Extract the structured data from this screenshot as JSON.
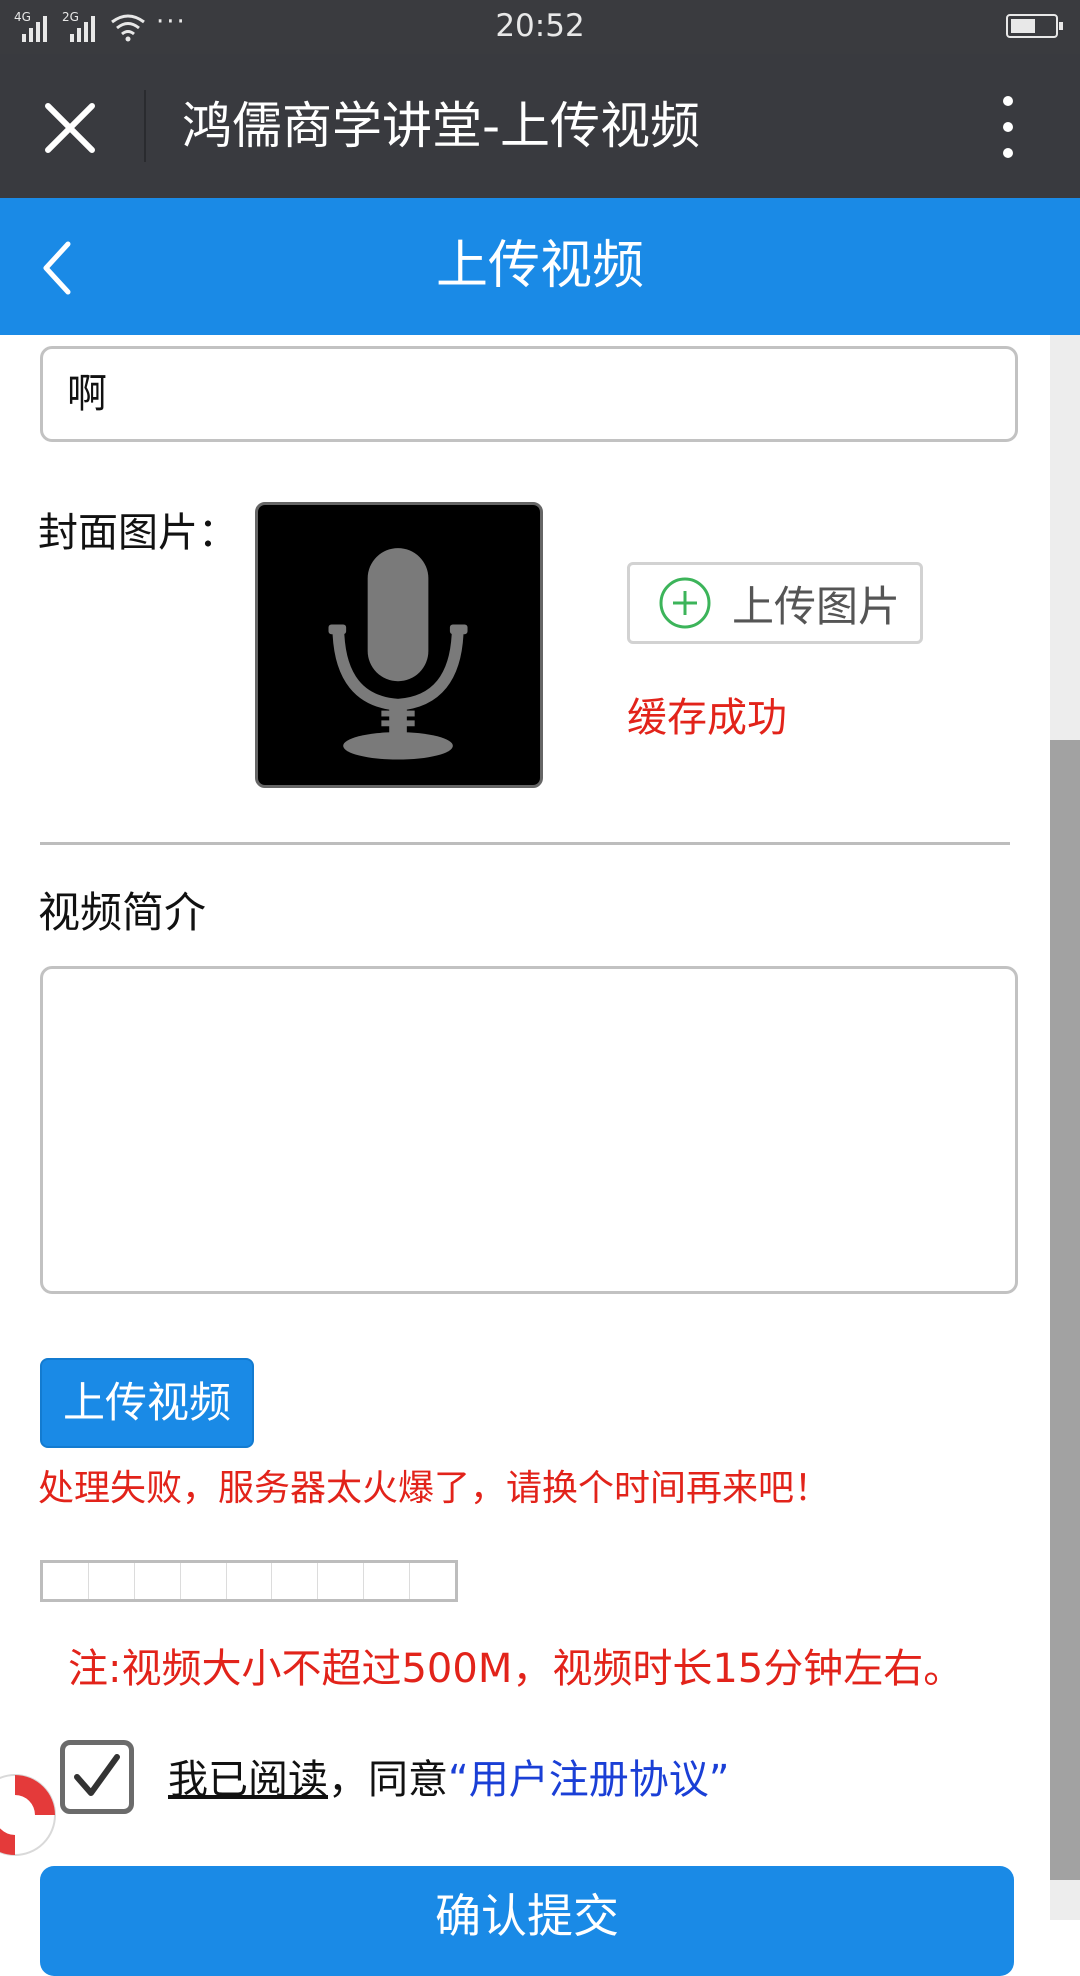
{
  "status_bar": {
    "network_1": "4G",
    "network_2": "2G",
    "more_dots": "···",
    "time": "20:52"
  },
  "wechat_nav": {
    "title": "鸿儒商学讲堂-上传视频"
  },
  "header": {
    "title": "上传视频"
  },
  "form": {
    "title_value": "啊",
    "cover_label": "封面图片：",
    "upload_image_label": "上传图片",
    "cache_status": "缓存成功",
    "intro_label": "视频简介",
    "intro_value": "",
    "upload_video_label": "上传视频",
    "error_message": "处理失败，服务器太火爆了，请换个时间再来吧！",
    "progress": 0,
    "note": "注:视频大小不超过500M，视频时长15分钟左右。",
    "agree": {
      "checked": true,
      "read_text": "我已阅读",
      "comma_text": "，同意",
      "link_text": "“用户注册协议”"
    },
    "submit_label": "确认提交"
  },
  "colors": {
    "accent": "#1a8ae6",
    "error": "#e2231a",
    "link": "#1a3fd6",
    "nav_bg": "#393a3f"
  },
  "icons": [
    "close-icon",
    "more-vertical-icon",
    "back-chevron-icon",
    "microphone-icon",
    "plus-circle-icon",
    "checkmark-icon",
    "lifebuoy-icon",
    "wifi-icon",
    "battery-icon"
  ]
}
